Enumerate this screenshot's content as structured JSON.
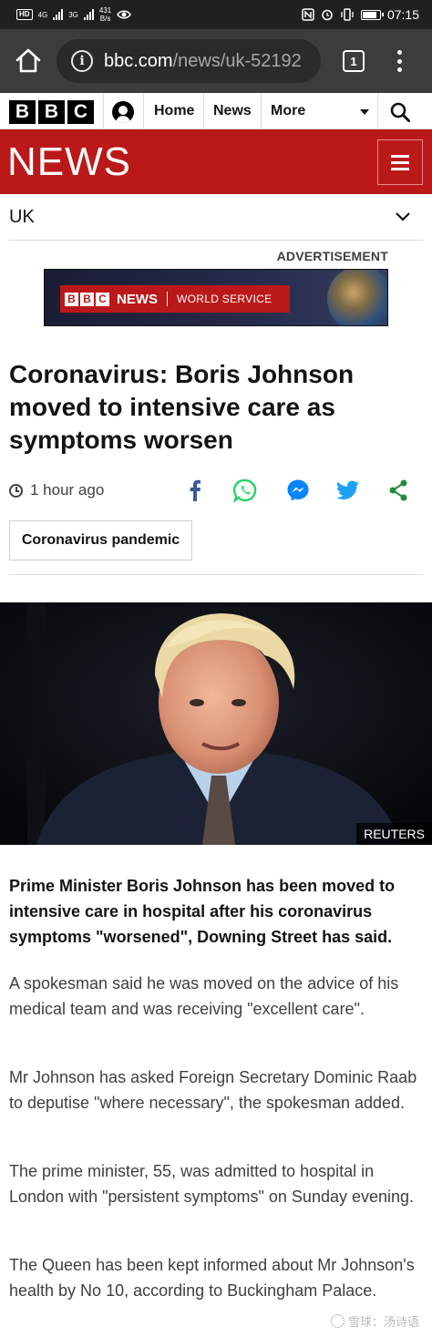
{
  "status_bar": {
    "left_badge": "HD",
    "network_1": "4G",
    "network_2": "3G",
    "speed_value": "431",
    "speed_unit": "B/s",
    "time": "07:15"
  },
  "browser": {
    "url_host": "bbc.com",
    "url_path": "/news/uk-52192",
    "tab_count": "1"
  },
  "bbc_nav": {
    "logo_letters": [
      "B",
      "B",
      "C"
    ],
    "links": [
      "Home",
      "News",
      "More"
    ]
  },
  "news_banner": {
    "wordmark": "NEWS"
  },
  "section": {
    "label": "UK"
  },
  "advert": {
    "label": "ADVERTISEMENT",
    "logo_letters": [
      "B",
      "B",
      "C"
    ],
    "news_text": "NEWS",
    "service_text": "WORLD SERVICE"
  },
  "article": {
    "headline": "Coronavirus: Boris Johnson moved to intensive care as symptoms worsen",
    "timestamp": "1 hour ago",
    "share_icons": [
      "facebook-icon",
      "whatsapp-icon",
      "messenger-icon",
      "twitter-icon",
      "share-icon"
    ],
    "tag": "Coronavirus pandemic",
    "photo_credit": "REUTERS",
    "lede": "Prime Minister Boris Johnson has been moved to intensive care in hospital after his coronavirus symptoms \"worsened\", Downing Street has said.",
    "paragraphs": [
      "A spokesman said he was moved on the advice of his medical team and was receiving \"excellent care\".",
      "Mr Johnson has asked Foreign Secretary Dominic Raab to deputise \"where necessary\", the spokesman added.",
      "The prime minister, 55, was admitted to hospital in London with \"persistent symptoms\" on Sunday evening.",
      "The Queen has been kept informed about Mr Johnson's health by No 10, according to Buckingham Palace."
    ]
  },
  "watermark": "雪球：汤诗语",
  "colors": {
    "bbc_red": "#bb1919",
    "browser_toolbar": "#3c3c3c",
    "status_bar": "#202020",
    "facebook": "#3b5998",
    "whatsapp": "#25d366",
    "messenger": "#0084ff",
    "twitter": "#1da1f2",
    "share_green": "#208c3c"
  },
  "status_indicators": {
    "battery_level_percent": 85
  }
}
